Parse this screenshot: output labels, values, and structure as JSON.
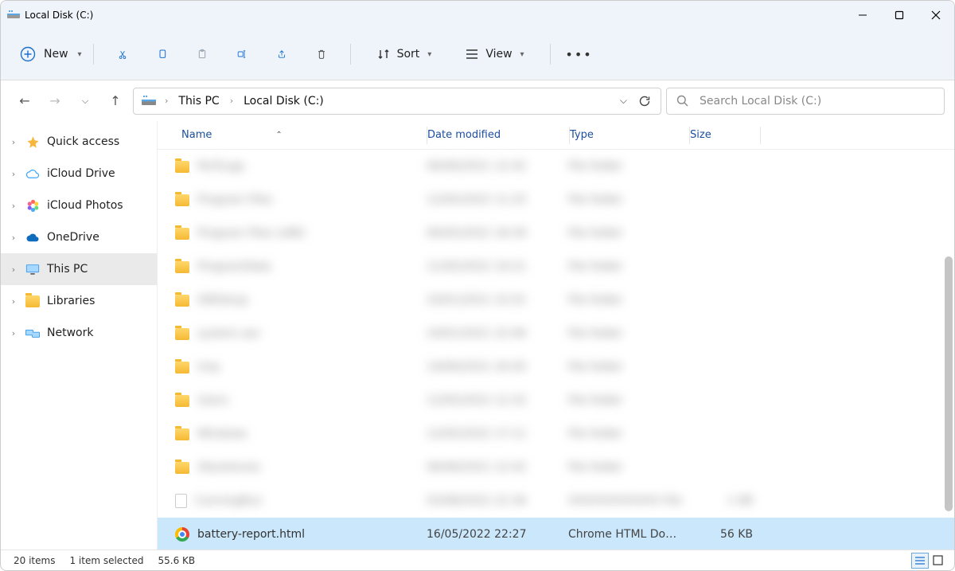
{
  "window": {
    "title": "Local Disk (C:)"
  },
  "toolbar": {
    "new_label": "New",
    "sort_label": "Sort",
    "view_label": "View"
  },
  "breadcrumbs": {
    "root": "This PC",
    "current": "Local Disk (C:)"
  },
  "search": {
    "placeholder": "Search Local Disk (C:)"
  },
  "sidebar": {
    "items": [
      {
        "label": "Quick access",
        "icon": "star",
        "color": "#f6b73c"
      },
      {
        "label": "iCloud Drive",
        "icon": "cloud",
        "color": "#39a5ff"
      },
      {
        "label": "iCloud Photos",
        "icon": "photos",
        "color": "#e85d9b"
      },
      {
        "label": "OneDrive",
        "icon": "cloud-solid",
        "color": "#0f6cbd"
      },
      {
        "label": "This PC",
        "icon": "monitor",
        "color": "#1a6fcf",
        "selected": true
      },
      {
        "label": "Libraries",
        "icon": "folder",
        "color": "#f5b933"
      },
      {
        "label": "Network",
        "icon": "network",
        "color": "#1a6fcf"
      }
    ]
  },
  "columns": {
    "name": "Name",
    "date": "Date modified",
    "type": "Type",
    "size": "Size"
  },
  "rows": {
    "blurred": [
      {
        "name": "PerfLogs",
        "date": "06/06/2021 12:42",
        "type": "File folder",
        "size": ""
      },
      {
        "name": "Program Files",
        "date": "12/05/2022 11:25",
        "type": "File folder",
        "size": ""
      },
      {
        "name": "Program Files (x86)",
        "date": "06/05/2022 18:39",
        "type": "File folder",
        "size": ""
      },
      {
        "name": "ProgramData",
        "date": "11/05/2022 19:21",
        "type": "File folder",
        "size": ""
      },
      {
        "name": "SWSetup",
        "date": "24/01/2021 22:01",
        "type": "File folder",
        "size": ""
      },
      {
        "name": "system.sav",
        "date": "24/01/2021 22:06",
        "type": "File folder",
        "size": ""
      },
      {
        "name": "tmp",
        "date": "14/06/2021 20:05",
        "type": "File folder",
        "size": ""
      },
      {
        "name": "Users",
        "date": "12/05/2022 12:32",
        "type": "File folder",
        "size": ""
      },
      {
        "name": "Windows",
        "date": "12/05/2022 17:11",
        "type": "File folder",
        "size": ""
      },
      {
        "name": "Xbootemes",
        "date": "06/06/2021 12:42",
        "type": "File folder",
        "size": ""
      },
      {
        "name": "ConningRun",
        "date": "03/08/2022 22:36",
        "type": "XXXXXXXXXXXX File",
        "size": "1 KB",
        "fileicon": true
      }
    ],
    "selected": {
      "name": "battery-report.html",
      "date": "16/05/2022 22:27",
      "type": "Chrome HTML Do…",
      "size": "56 KB"
    }
  },
  "status": {
    "count": "20 items",
    "selection": "1 item selected",
    "size": "55.6 KB"
  }
}
